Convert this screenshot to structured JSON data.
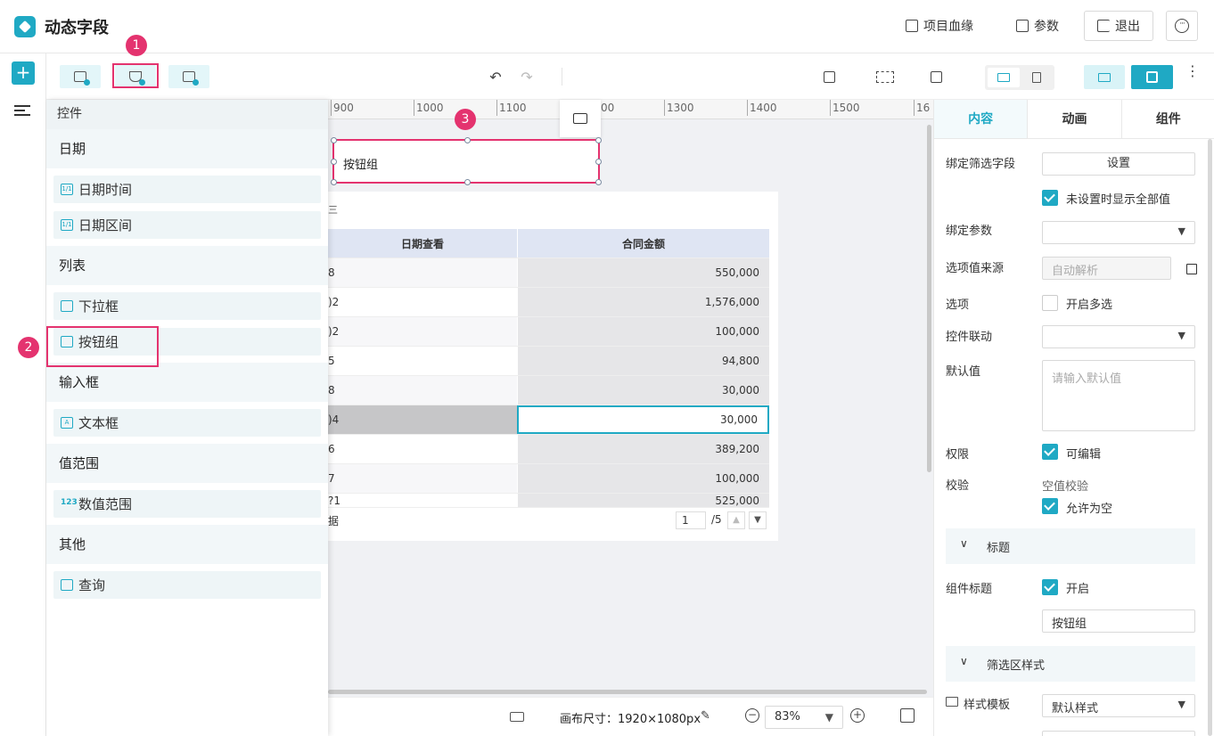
{
  "header": {
    "title": "动态字段",
    "lineage_label": "项目血缘",
    "params_label": "参数",
    "exit_label": "退出"
  },
  "toolbar": {
    "undo": "↶",
    "redo": "↷",
    "more": "⋮"
  },
  "ruler": {
    "ticks": [
      "900",
      "1000",
      "1100",
      "00",
      "1300",
      "1400",
      "1500",
      "16"
    ]
  },
  "canvas": {
    "widget_label": "按钮组",
    "table": {
      "headers": [
        "日期查看",
        "合同金额"
      ],
      "rows": [
        [
          "8",
          "550,000"
        ],
        [
          ")2",
          "1,576,000"
        ],
        [
          ")2",
          "100,000"
        ],
        [
          "5",
          "94,800"
        ],
        [
          "8",
          "30,000"
        ],
        [
          ")4",
          "30,000"
        ],
        [
          "6",
          "389,200"
        ],
        [
          "7",
          "100,000"
        ],
        [
          "?1",
          "525,000"
        ]
      ],
      "pager_text": "据",
      "page_value": "1",
      "page_total": "/5",
      "corner_char": "三"
    }
  },
  "status": {
    "canvas_size": "画布尺寸：1920×1080px",
    "zoom": "83%"
  },
  "component_panel": {
    "title": "控件",
    "groups": [
      {
        "name": "日期",
        "items": [
          "日期时间",
          "日期区间"
        ]
      },
      {
        "name": "列表",
        "items": [
          "下拉框",
          "按钮组"
        ]
      },
      {
        "name": "输入框",
        "items": [
          "文本框"
        ]
      },
      {
        "name": "值范围",
        "items": [
          "数值范围"
        ]
      },
      {
        "name": "其他",
        "items": [
          "查询"
        ]
      }
    ]
  },
  "badges": [
    "1",
    "2",
    "3"
  ],
  "props": {
    "tabs": [
      "内容",
      "动画",
      "组件"
    ],
    "bind_filter_label": "绑定筛选字段",
    "bind_filter_btn": "设置",
    "show_all_label": "未设置时显示全部值",
    "bind_param_label": "绑定参数",
    "option_source_label": "选项值来源",
    "option_source_placeholder": "自动解析",
    "options_label": "选项",
    "multi_label": "开启多选",
    "linkage_label": "控件联动",
    "default_label": "默认值",
    "default_placeholder": "请输入默认值",
    "permission_label": "权限",
    "editable_label": "可编辑",
    "validate_label": "校验",
    "empty_check_label": "空值校验",
    "allow_empty_label": "允许为空",
    "title_section": "标题",
    "comp_title_label": "组件标题",
    "comp_title_on": "开启",
    "comp_title_value": "按钮组",
    "filter_style_section": "筛选区样式",
    "style_template_label": "样式模板",
    "style_template_value": "默认样式"
  },
  "colors": {
    "accent": "#1fa9c4",
    "highlight": "#e4336f"
  }
}
